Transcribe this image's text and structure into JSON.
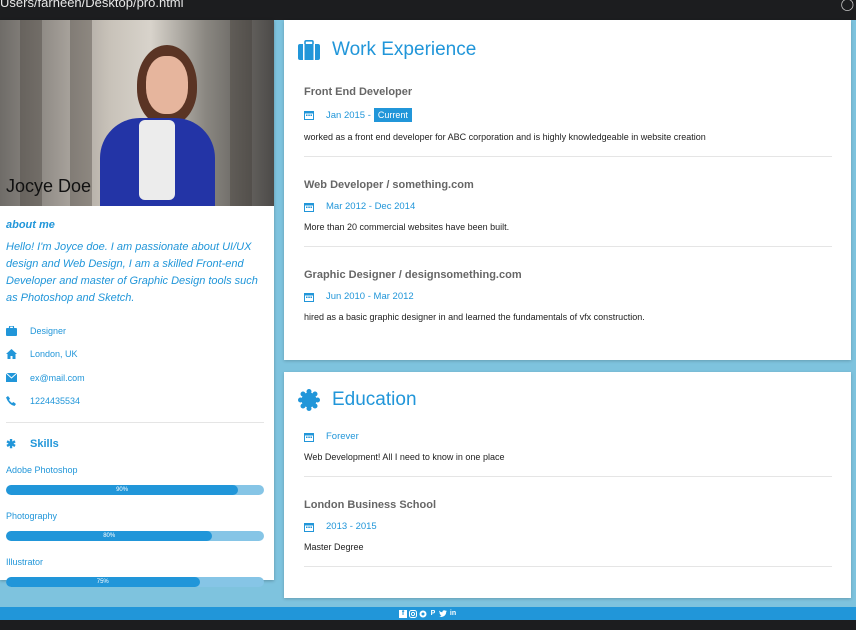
{
  "window": {
    "path": "Users/farheen/Desktop/pro.html"
  },
  "profile": {
    "name": "Jocye Doe",
    "about_heading": "about me",
    "about_text": "Hello! I'm Joyce doe. I am passionate about UI/UX design and Web Design, I am a skilled Front-end Developer and master of Graphic Design tools such as Photoshop and Sketch.",
    "info": [
      {
        "icon": "briefcase-icon",
        "text": "Designer"
      },
      {
        "icon": "home-icon",
        "text": "London, UK"
      },
      {
        "icon": "envelope-icon",
        "text": "ex@mail.com"
      },
      {
        "icon": "phone-icon",
        "text": "1224435534"
      }
    ],
    "skills_heading": "Skills",
    "skills": [
      {
        "name": "Adobe Photoshop",
        "label": "90%",
        "value": 90
      },
      {
        "name": "Photography",
        "label": "80%",
        "value": 80
      },
      {
        "name": "Illustrator",
        "label": "75%",
        "value": 75
      }
    ]
  },
  "work": {
    "heading": "Work Experience",
    "entries": [
      {
        "title": "Front End Developer",
        "date": "Jan 2015 -",
        "badge": "Current",
        "desc": "worked as a front end developer for ABC corporation and is highly knowledgeable in website creation"
      },
      {
        "title": "Web Developer / something.com",
        "date": "Mar 2012 - Dec 2014",
        "desc": "More than 20 commercial websites have been built."
      },
      {
        "title": "Graphic Designer / designsomething.com",
        "date": "Jun 2010 - Mar 2012",
        "desc": "hired as a basic graphic designer in and learned the fundamentals of vfx construction."
      }
    ]
  },
  "education": {
    "heading": "Education",
    "entries": [
      {
        "title": "",
        "date": "Forever",
        "desc": "Web Development! All I need to know in one place"
      },
      {
        "title": "London Business School",
        "date": "2013 - 2015",
        "desc": "Master Degree"
      }
    ]
  },
  "footer": {
    "icons": [
      "facebook-icon",
      "instagram-icon",
      "snapchat-icon",
      "pinterest-icon",
      "twitter-icon",
      "linkedin-icon"
    ]
  },
  "colors": {
    "accent": "#2196d9",
    "bar_track": "#86c5e6",
    "page_bg": "#7ec3de"
  }
}
